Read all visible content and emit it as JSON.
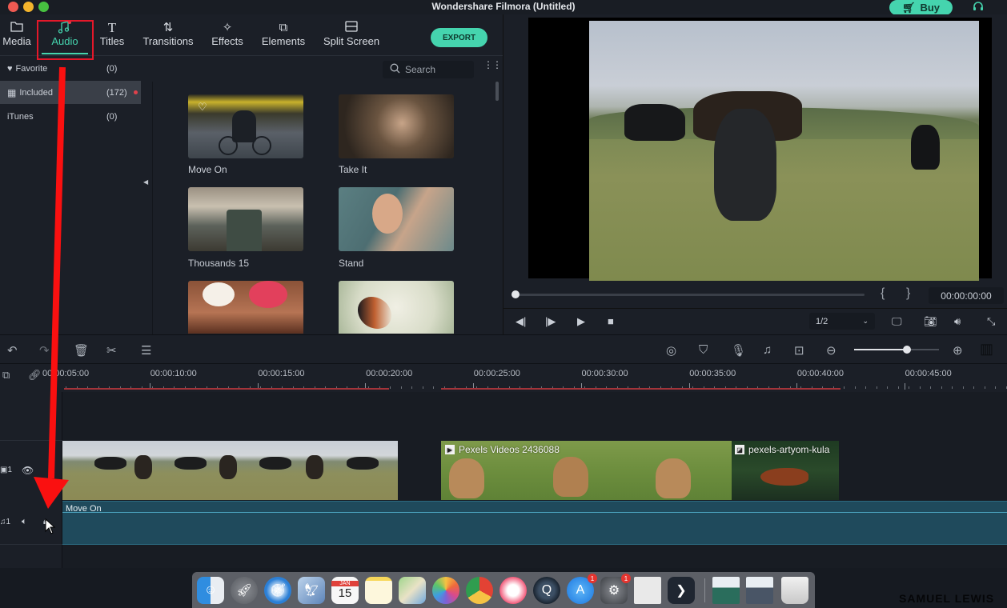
{
  "window": {
    "title": "Wondershare Filmora (Untitled)",
    "buy_label": "Buy",
    "traffic_lights": [
      "close",
      "minimize",
      "zoom"
    ]
  },
  "colors": {
    "accent": "#45d4ae",
    "annotation_red": "#e4182a",
    "audio_clip": "#1f4a5c"
  },
  "tabs": [
    {
      "label": "Media",
      "icon": "folder-icon",
      "active": false
    },
    {
      "label": "Audio",
      "icon": "music-note-icon",
      "active": true
    },
    {
      "label": "Titles",
      "icon": "text-icon",
      "active": false
    },
    {
      "label": "Transitions",
      "icon": "transition-icon",
      "active": false
    },
    {
      "label": "Effects",
      "icon": "sparkle-icon",
      "active": false
    },
    {
      "label": "Elements",
      "icon": "elements-icon",
      "active": false
    },
    {
      "label": "Split Screen",
      "icon": "split-screen-icon",
      "active": false
    }
  ],
  "export_label": "EXPORT",
  "sidebar": {
    "items": [
      {
        "label": "Favorite",
        "count": "(0)",
        "icon": "heart-icon"
      },
      {
        "label": "Included",
        "count": "(172)",
        "icon": "grid-icon",
        "selected": true
      },
      {
        "label": "iTunes",
        "count": "(0)"
      }
    ]
  },
  "search": {
    "placeholder": "Search"
  },
  "audio_items": [
    {
      "title": "Move On"
    },
    {
      "title": "Take It"
    },
    {
      "title": "Thousands 15"
    },
    {
      "title": "Stand"
    },
    {
      "title": ""
    },
    {
      "title": ""
    }
  ],
  "preview": {
    "timecode": "00:00:00:00",
    "quality": "1/2",
    "progress": 0
  },
  "timeline": {
    "ruler_labels": [
      "00:00:05:00",
      "00:00:10:00",
      "00:00:15:00",
      "00:00:20:00",
      "00:00:25:00",
      "00:00:30:00",
      "00:00:35:00",
      "00:00:40:00",
      "00:00:45:00"
    ],
    "zoom_level": 0.62,
    "tracks": {
      "video": {
        "index": "1",
        "clips": [
          {
            "name": ""
          },
          {
            "name": "Pexels Videos 2436088",
            "type": "video"
          },
          {
            "name": "pexels-artyom-kula",
            "type": "image"
          }
        ]
      },
      "audio": {
        "index": "1",
        "clips": [
          {
            "name": "Move On"
          }
        ]
      }
    }
  },
  "dock": {
    "apps": [
      {
        "name": "Finder"
      },
      {
        "name": "Launchpad"
      },
      {
        "name": "Safari"
      },
      {
        "name": "Mail"
      },
      {
        "name": "Calendar",
        "month": "JAN",
        "day": "15"
      },
      {
        "name": "Notes"
      },
      {
        "name": "Maps"
      },
      {
        "name": "Photos"
      },
      {
        "name": "Chrome"
      },
      {
        "name": "Music"
      },
      {
        "name": "QuickTime"
      },
      {
        "name": "App Store",
        "badge": "1"
      },
      {
        "name": "System Preferences",
        "badge": "1"
      },
      {
        "name": "Document"
      },
      {
        "name": "Filmora"
      },
      {
        "name": "Window 1"
      },
      {
        "name": "Window 2"
      },
      {
        "name": "Trash"
      }
    ]
  },
  "watermark": "SAMUEL LEWIS"
}
